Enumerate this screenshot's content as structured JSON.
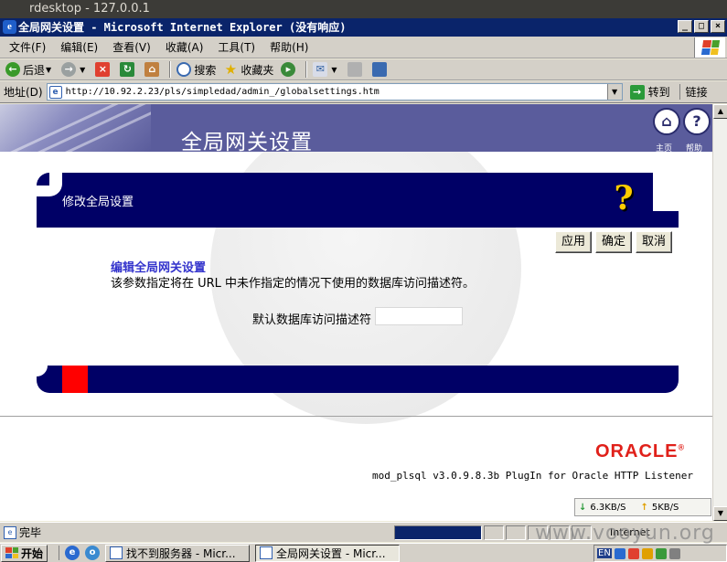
{
  "rdesktop": {
    "title": "rdesktop - 127.0.0.1"
  },
  "window": {
    "title": "全局网关设置 - Microsoft Internet Explorer (没有响应)"
  },
  "menu": {
    "items": [
      "文件(F)",
      "编辑(E)",
      "查看(V)",
      "收藏(A)",
      "工具(T)",
      "帮助(H)"
    ]
  },
  "toolbar": {
    "back": "后退",
    "search": "搜索",
    "favorites": "收藏夹"
  },
  "address": {
    "label": "地址(D)",
    "url": "http://10.92.2.23/pls/simpledad/admin_/globalsettings.htm",
    "go": "转到",
    "links": "链接"
  },
  "page": {
    "title": "全局网关设置",
    "home_label": "主页",
    "help_label": "帮助",
    "section_title": "修改全局设置",
    "buttons": {
      "apply": "应用",
      "ok": "确定",
      "cancel": "取消"
    },
    "edit_heading": "编辑全局网关设置",
    "description": "该参数指定将在 URL 中未作指定的情况下使用的数据库访问描述符。",
    "field_label": "默认数据库访问描述符",
    "field_value": "",
    "oracle_logo": "ORACLE",
    "plugin": "mod_plsql v3.0.9.8.3b PlugIn for Oracle HTTP Listener"
  },
  "speed": {
    "down": "6.3KB/S",
    "up": "5KB/S"
  },
  "status": {
    "text": "完毕",
    "zone": "Internet"
  },
  "taskbar": {
    "start": "开始",
    "tasks": [
      "找不到服务器 - Micr...",
      "全局网关设置 - Micr..."
    ],
    "lang": "EN"
  },
  "watermark": "www.vooyun.org"
}
